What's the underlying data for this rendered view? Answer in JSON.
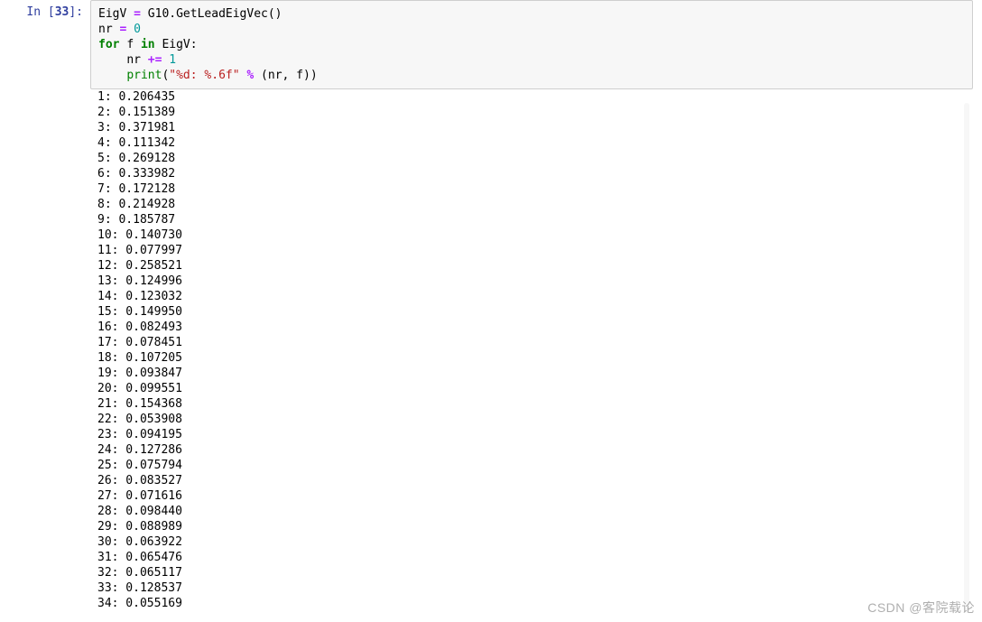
{
  "prompt": {
    "label": "In",
    "number": "33"
  },
  "code": {
    "line1": {
      "lhs": "EigV",
      "op": "=",
      "rhs": "G10.GetLeadEigVec()"
    },
    "line2": {
      "lhs": "nr",
      "op": "=",
      "rhs": "0"
    },
    "line3": {
      "kw1": "for",
      "var": "f",
      "kw2": "in",
      "iter": "EigV",
      "colon": ":"
    },
    "line4": {
      "indent": "    ",
      "lhs": "nr",
      "op": "+=",
      "rhs": "1"
    },
    "line5": {
      "indent": "    ",
      "fn": "print",
      "open": "(",
      "str": "\"%d: %.6f\"",
      "pct": "%",
      "args": "(nr, f)",
      "close": ")"
    }
  },
  "output_values": [
    "0.206435",
    "0.151389",
    "0.371981",
    "0.111342",
    "0.269128",
    "0.333982",
    "0.172128",
    "0.214928",
    "0.185787",
    "0.140730",
    "0.077997",
    "0.258521",
    "0.124996",
    "0.123032",
    "0.149950",
    "0.082493",
    "0.078451",
    "0.107205",
    "0.093847",
    "0.099551",
    "0.154368",
    "0.053908",
    "0.094195",
    "0.127286",
    "0.075794",
    "0.083527",
    "0.071616",
    "0.098440",
    "0.088989",
    "0.063922",
    "0.065476",
    "0.065117",
    "0.128537",
    "0.055169"
  ],
  "watermark": "CSDN @客院载论"
}
